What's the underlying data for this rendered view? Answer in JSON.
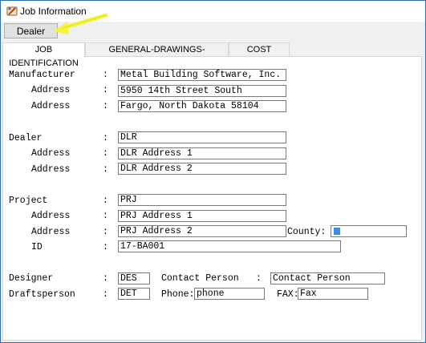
{
  "window": {
    "title": "Job Information"
  },
  "toolbar": {
    "dealer_button": "Dealer"
  },
  "tabs": [
    {
      "label": "JOB IDENTIFICATION",
      "active": true
    },
    {
      "label": "GENERAL-DRAWINGS-CALCULATIONS",
      "active": false
    },
    {
      "label": "COST FACTORS",
      "active": false
    }
  ],
  "form": {
    "manufacturer": {
      "label": "Manufacturer",
      "value": "Metal Building Software, Inc."
    },
    "manufacturer_address1": {
      "label": "Address",
      "value": "5950 14th Street South"
    },
    "manufacturer_address2": {
      "label": "Address",
      "value": "Fargo, North Dakota 58104"
    },
    "dealer": {
      "label": "Dealer",
      "value": "DLR"
    },
    "dealer_address1": {
      "label": "Address",
      "value": "DLR Address 1"
    },
    "dealer_address2": {
      "label": "Address",
      "value": "DLR Address 2"
    },
    "project": {
      "label": "Project",
      "value": "PRJ"
    },
    "project_address1": {
      "label": "Address",
      "value": "PRJ Address 1"
    },
    "project_address2": {
      "label": "Address",
      "value": "PRJ Address 2"
    },
    "county": {
      "label": "County:",
      "value": ""
    },
    "id": {
      "label": "ID",
      "value": "17-BA001"
    },
    "designer": {
      "label": "Designer",
      "value": "DES"
    },
    "contact_person": {
      "label": "Contact Person",
      "value": "Contact Person"
    },
    "draftsperson": {
      "label": "Draftsperson",
      "value": "DET"
    },
    "phone": {
      "label": "Phone:",
      "value": "phone"
    },
    "fax": {
      "label": "FAX:",
      "value": "Fax"
    },
    "colon": ":"
  },
  "colors": {
    "highlight_arrow": "#f5f53c",
    "cursor": "#3c8de6"
  }
}
